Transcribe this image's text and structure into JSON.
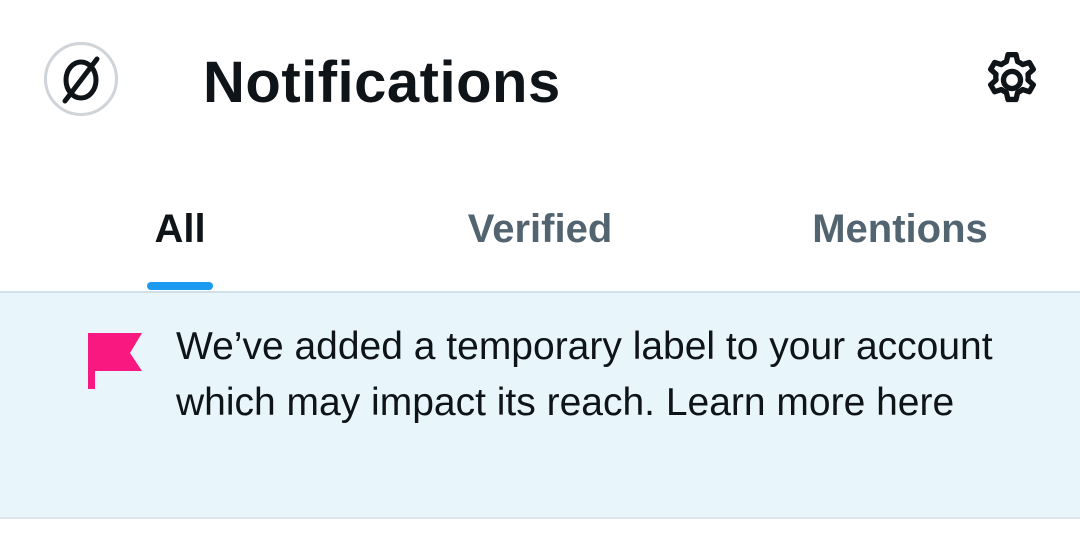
{
  "header": {
    "avatar_icon": "avatar-null-symbol-icon",
    "title": "Notifications",
    "settings_icon": "gear-icon"
  },
  "tabs": [
    {
      "label": "All",
      "active": true
    },
    {
      "label": "Verified",
      "active": false
    },
    {
      "label": "Mentions",
      "active": false
    }
  ],
  "notice": {
    "icon": "flag-icon",
    "icon_color": "#f91880",
    "text": "We’ve added a temporary label to your account which may impact its reach. Learn more here",
    "background": "#e8f6fc"
  },
  "colors": {
    "accent": "#1d9bf0",
    "text_primary": "#0f1419",
    "text_secondary": "#536471"
  }
}
